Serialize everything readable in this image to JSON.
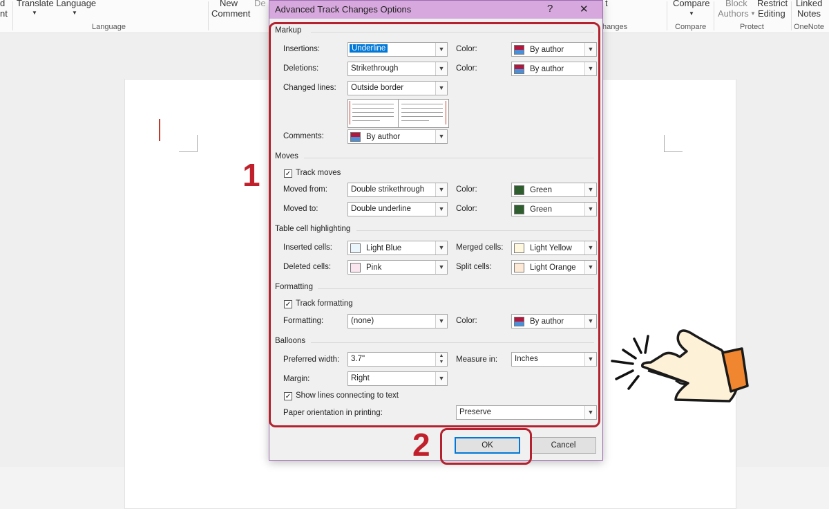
{
  "ribbon": {
    "left_partial_1": "d",
    "left_partial_2": "nt",
    "translate": "Translate Language",
    "language_group": "Language",
    "new_comment_1": "New",
    "new_comment_2": "Comment",
    "del_partial": "De",
    "changes_partial": "hanges",
    "t_partial": "t",
    "compare": "Compare",
    "compare_group": "Compare",
    "block_1": "Block",
    "block_2": "Authors",
    "restrict_1": "Restrict",
    "restrict_2": "Editing",
    "protect_group": "Protect",
    "linked_1": "Linked",
    "linked_2": "Notes",
    "onenote_group": "OneNote"
  },
  "dialog": {
    "title": "Advanced Track Changes Options",
    "help": "?",
    "close": "✕",
    "markup": {
      "heading": "Markup",
      "insertions_label": "Insertions:",
      "insertions_value": "Underline",
      "deletions_label": "Deletions:",
      "deletions_value": "Strikethrough",
      "changed_lines_label": "Changed lines:",
      "changed_lines_value": "Outside border",
      "color_label": "Color:",
      "insert_color": "By author",
      "delete_color": "By author",
      "comments_label": "Comments:",
      "comments_value": "By author"
    },
    "moves": {
      "heading": "Moves",
      "track_moves": "Track moves",
      "moved_from_label": "Moved from:",
      "moved_from_value": "Double strikethrough",
      "moved_to_label": "Moved to:",
      "moved_to_value": "Double underline",
      "color_label": "Color:",
      "from_color": "Green",
      "to_color": "Green"
    },
    "table": {
      "heading": "Table cell highlighting",
      "inserted_label": "Inserted cells:",
      "inserted_value": "Light Blue",
      "deleted_label": "Deleted cells:",
      "deleted_value": "Pink",
      "merged_label": "Merged cells:",
      "merged_value": "Light Yellow",
      "split_label": "Split cells:",
      "split_value": "Light Orange"
    },
    "formatting": {
      "heading": "Formatting",
      "track_formatting": "Track formatting",
      "formatting_label": "Formatting:",
      "formatting_value": "(none)",
      "color_label": "Color:",
      "color_value": "By author"
    },
    "balloons": {
      "heading": "Balloons",
      "preferred_width_label": "Preferred width:",
      "preferred_width_value": "3.7\"",
      "measure_label": "Measure in:",
      "measure_value": "Inches",
      "margin_label": "Margin:",
      "margin_value": "Right",
      "show_lines": "Show lines connecting to text",
      "paper_label": "Paper orientation in printing:",
      "paper_value": "Preserve"
    },
    "ok": "OK",
    "cancel": "Cancel"
  },
  "annotations": {
    "step1": "1",
    "step2": "2"
  },
  "colors": {
    "by_author_top": "#b5163b",
    "by_author_bottom": "#4a90d9",
    "green": "#2e5e2e",
    "light_blue": "#eaf6fc",
    "pink": "#fbe6ef",
    "light_yellow": "#fff8df",
    "light_orange": "#fde9d6",
    "highlight_red": "#b3222e",
    "title_bar": "#d7a8de"
  }
}
